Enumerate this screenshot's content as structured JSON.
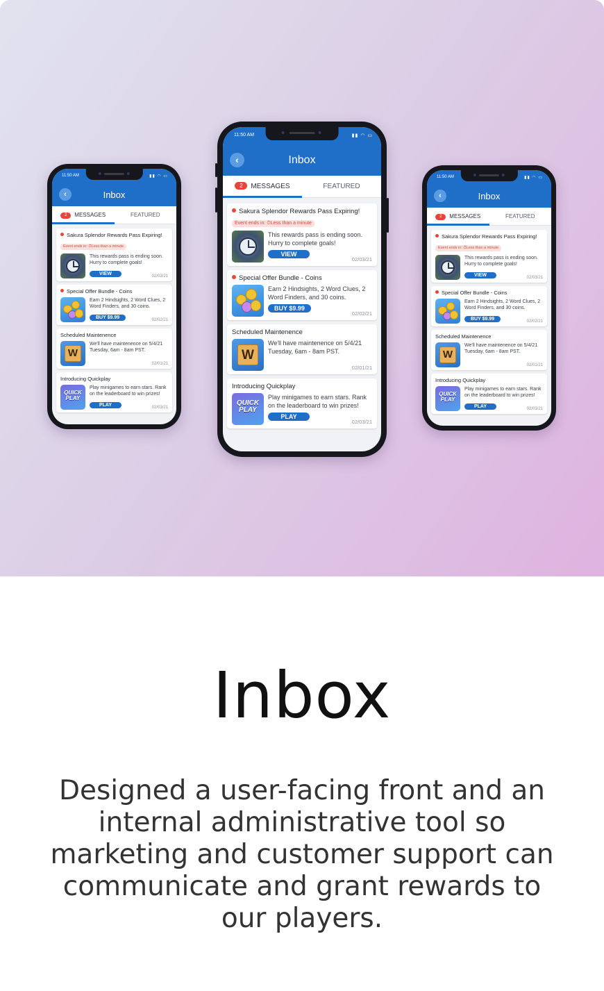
{
  "phone": {
    "status_time": "11:50 AM",
    "status_icons": "▮▮ ◠ ▭",
    "back_icon": "‹",
    "title": "Inbox",
    "tabs": {
      "messages_badge": "2",
      "messages": "MESSAGES",
      "featured": "FEATURED"
    },
    "cards": [
      {
        "title": "Sakura Splendor Rewards Pass Expiring!",
        "event": "Event ends in: ⏱Less than a minute",
        "text": "This rewards pass is ending soon. Hurry to complete goals!",
        "button": "VIEW",
        "date": "02/03/21"
      },
      {
        "title": "Special Offer Bundle - Coins",
        "text": "Earn 2 Hindsights, 2 Word Clues, 2 Word Finders, and 30 coins.",
        "button": "BUY $9.99",
        "date": "02/02/21"
      },
      {
        "title": "Scheduled Maintenence",
        "text": "We'll have maintenence on 5/4/21 Tuesday, 6am - 8am PST.",
        "tile_letter": "W",
        "date": "02/01/21"
      },
      {
        "title": "Introducing Quickplay",
        "text": "Play minigames to earn stars. Rank on the leaderboard to win prizes!",
        "thumb_label": "QUICK PLAY",
        "button": "PLAY",
        "date": "02/03/21"
      }
    ]
  },
  "caption": {
    "title": "Inbox",
    "description": "Designed a user-facing front and an internal administrative tool so marketing and customer support can communicate and grant rewards to our players."
  },
  "colors": {
    "accent": "#1f6fc9",
    "alert": "#e6463a"
  }
}
